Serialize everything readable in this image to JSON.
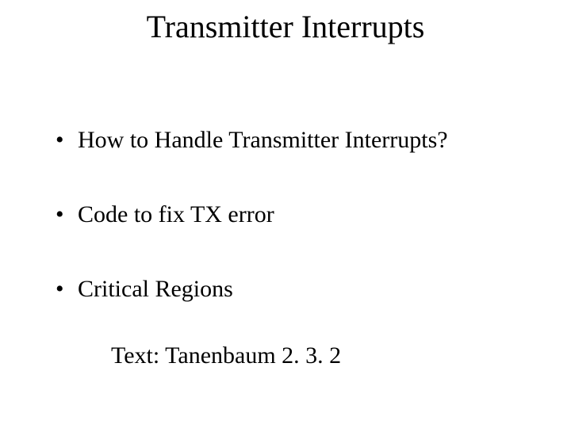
{
  "title": "Transmitter Interrupts",
  "bullets": [
    "How to Handle Transmitter Interrupts?",
    "Code to fix TX error",
    "Critical Regions"
  ],
  "footer": "Text: Tanenbaum 2. 3. 2"
}
